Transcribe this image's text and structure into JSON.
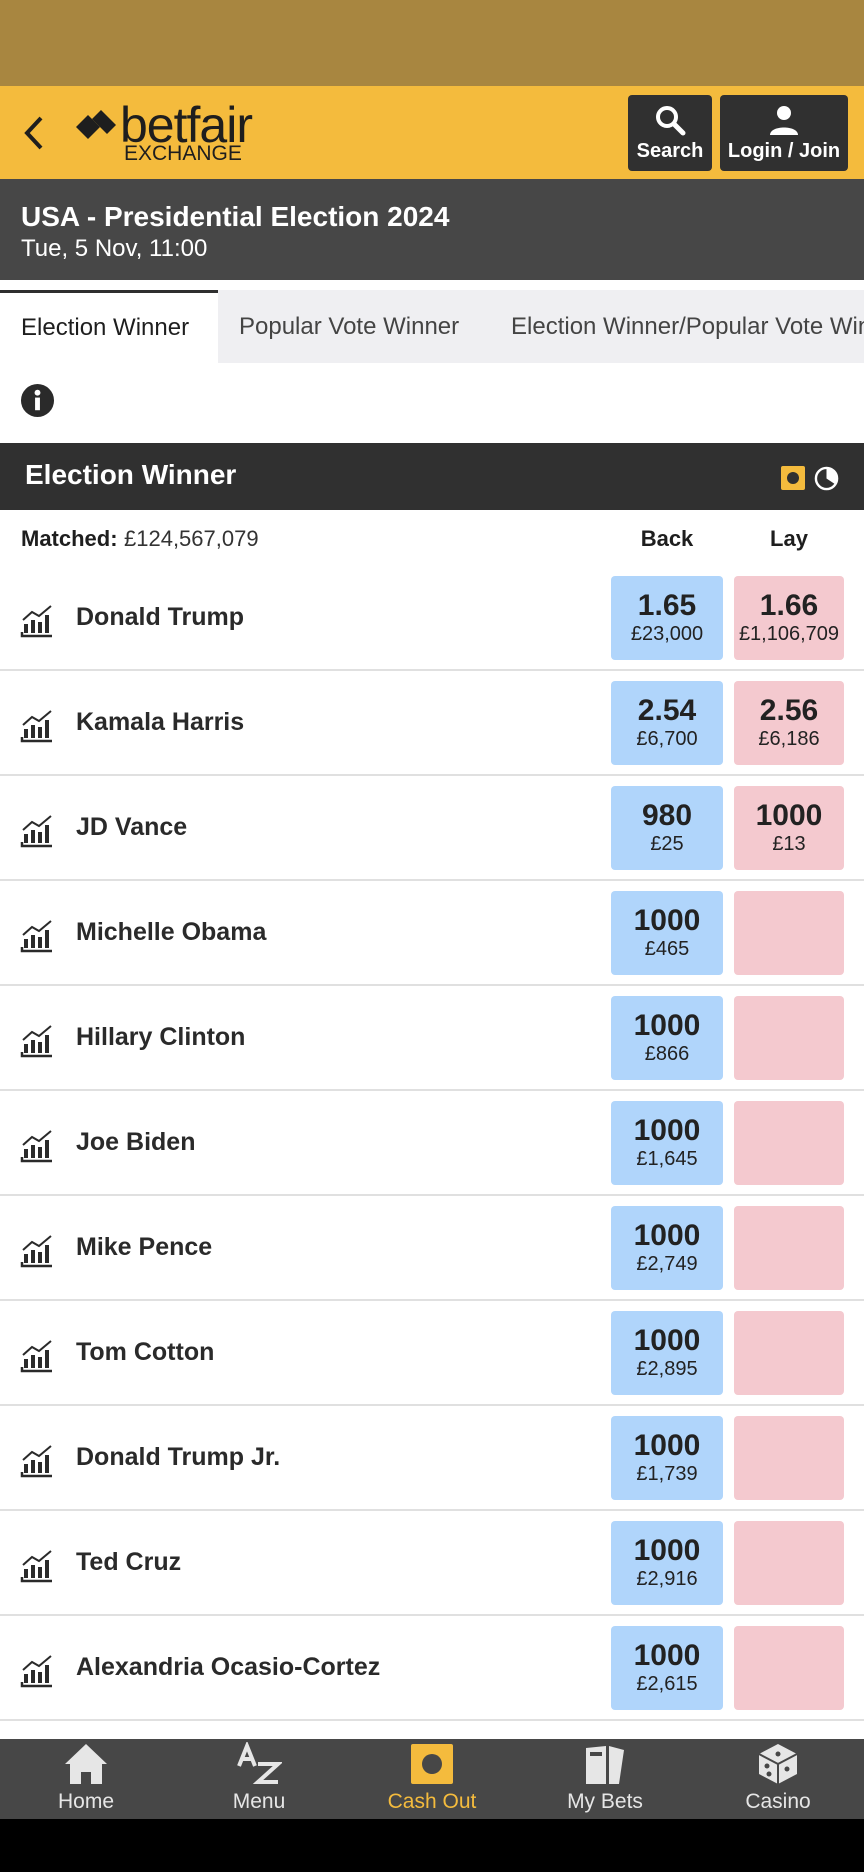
{
  "colors": {
    "brand_yellow": "#f4bb3d",
    "back_blue": "#b0d5fb",
    "lay_pink": "#f4c9cf",
    "dark_header": "#303030",
    "event_header": "#474747"
  },
  "header": {
    "logo_word": "betfair",
    "logo_sub": "EXCHANGE",
    "search_label": "Search",
    "login_label": "Login / Join"
  },
  "event": {
    "title": "USA - Presidential Election 2024",
    "date": "Tue, 5 Nov, 11:00"
  },
  "tabs": [
    {
      "label": "Election Winner",
      "active": true
    },
    {
      "label": "Popular Vote Winner",
      "active": false
    },
    {
      "label": "Election Winner/Popular Vote Winner",
      "active": false
    }
  ],
  "market": {
    "title": "Election Winner",
    "matched_label": "Matched:",
    "matched_value": "£124,567,079",
    "back_label": "Back",
    "lay_label": "Lay",
    "runners": [
      {
        "name": "Donald Trump",
        "back_odds": "1.65",
        "back_stake": "£23,000",
        "lay_odds": "1.66",
        "lay_stake": "£1,106,709"
      },
      {
        "name": "Kamala Harris",
        "back_odds": "2.54",
        "back_stake": "£6,700",
        "lay_odds": "2.56",
        "lay_stake": "£6,186"
      },
      {
        "name": "JD Vance",
        "back_odds": "980",
        "back_stake": "£25",
        "lay_odds": "1000",
        "lay_stake": "£13"
      },
      {
        "name": "Michelle Obama",
        "back_odds": "1000",
        "back_stake": "£465",
        "lay_odds": "",
        "lay_stake": ""
      },
      {
        "name": "Hillary Clinton",
        "back_odds": "1000",
        "back_stake": "£866",
        "lay_odds": "",
        "lay_stake": ""
      },
      {
        "name": "Joe Biden",
        "back_odds": "1000",
        "back_stake": "£1,645",
        "lay_odds": "",
        "lay_stake": ""
      },
      {
        "name": "Mike Pence",
        "back_odds": "1000",
        "back_stake": "£2,749",
        "lay_odds": "",
        "lay_stake": ""
      },
      {
        "name": "Tom Cotton",
        "back_odds": "1000",
        "back_stake": "£2,895",
        "lay_odds": "",
        "lay_stake": ""
      },
      {
        "name": "Donald Trump Jr.",
        "back_odds": "1000",
        "back_stake": "£1,739",
        "lay_odds": "",
        "lay_stake": ""
      },
      {
        "name": "Ted Cruz",
        "back_odds": "1000",
        "back_stake": "£2,916",
        "lay_odds": "",
        "lay_stake": ""
      },
      {
        "name": "Alexandria Ocasio-Cortez",
        "back_odds": "1000",
        "back_stake": "£2,615",
        "lay_odds": "",
        "lay_stake": ""
      }
    ]
  },
  "bottom_nav": [
    {
      "label": "Home",
      "icon": "home-icon",
      "active": false
    },
    {
      "label": "Menu",
      "icon": "az-menu-icon",
      "active": false
    },
    {
      "label": "Cash Out",
      "icon": "cash-out-icon",
      "active": true
    },
    {
      "label": "My Bets",
      "icon": "my-bets-icon",
      "active": false
    },
    {
      "label": "Casino",
      "icon": "dice-icon",
      "active": false
    }
  ]
}
